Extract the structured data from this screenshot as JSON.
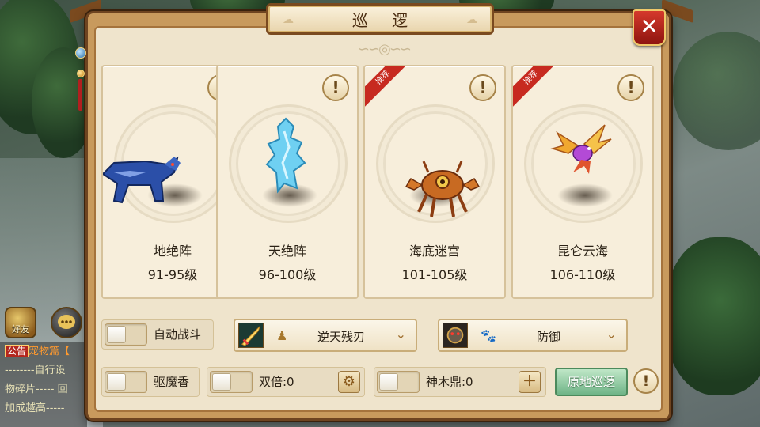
{
  "window": {
    "title": "巡 逻",
    "close_icon": "close-icon"
  },
  "cards": [
    {
      "name": "地绝阵",
      "level": "91-95级",
      "info": "!",
      "recommended": false,
      "creature": "blue-wolf"
    },
    {
      "name": "天绝阵",
      "level": "96-100级",
      "info": "!",
      "recommended": false,
      "creature": "ice-spirit"
    },
    {
      "name": "海底迷宫",
      "level": "101-105级",
      "info": "!",
      "recommended": true,
      "badge": "推荐",
      "creature": "crab"
    },
    {
      "name": "昆仑云海",
      "level": "106-110级",
      "info": "!",
      "recommended": true,
      "badge": "推荐",
      "creature": "phoenix"
    }
  ],
  "controls": {
    "auto_battle_label": "自动战斗",
    "weapon_select_value": "逆天残刃",
    "pet_select_value": "防御",
    "exorcise_label": "驱魔香",
    "double_label": "双倍:0",
    "tripod_label": "神木鼎:0",
    "patrol_here_button": "原地巡逻",
    "info": "!"
  },
  "hud": {
    "friend_button": "好友",
    "chat_lines": [
      {
        "tag": "公告",
        "text": "宠物篇【"
      },
      {
        "text": "--------自行设"
      },
      {
        "text": "物碎片----- 回"
      },
      {
        "text": "加成越高-----"
      }
    ]
  },
  "colors": {
    "accent": "#c72a20",
    "panel": "#efe4cc",
    "frame": "#6e4420",
    "green": "#6fb487"
  }
}
